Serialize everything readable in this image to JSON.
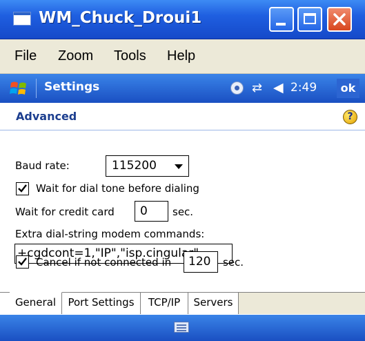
{
  "window": {
    "title": "WM_Chuck_Droui1"
  },
  "menu": {
    "items": [
      {
        "label": "File"
      },
      {
        "label": "Zoom"
      },
      {
        "label": "Tools"
      },
      {
        "label": "Help"
      }
    ]
  },
  "navbar": {
    "title": "Settings",
    "clock": "2:49",
    "ok_label": "ok"
  },
  "page": {
    "title": "Advanced"
  },
  "form": {
    "baud_label": "Baud rate:",
    "baud_value": "115200",
    "dial_tone_label": "Wait for dial tone before dialing",
    "dial_tone_checked": true,
    "credit_label": "Wait for credit card",
    "credit_value": "0",
    "credit_unit": "sec.",
    "extra_label": "Extra dial-string modem commands:",
    "extra_value": "+cgdcont=1,\"IP\",\"isp.cingular\"",
    "cancel_label": "Cancel if not connected in",
    "cancel_value": "120",
    "cancel_unit": "sec.",
    "cancel_checked": true
  },
  "tabs": [
    {
      "label": "General",
      "active": true
    },
    {
      "label": "Port Settings",
      "active": false
    },
    {
      "label": "TCP/IP",
      "active": false
    },
    {
      "label": "Servers",
      "active": false
    }
  ],
  "colors": {
    "titlebar": "#1f5fe0",
    "navbar": "#2a6ad8",
    "menubar": "#ece9d8",
    "page_title": "#1c3e8f"
  }
}
